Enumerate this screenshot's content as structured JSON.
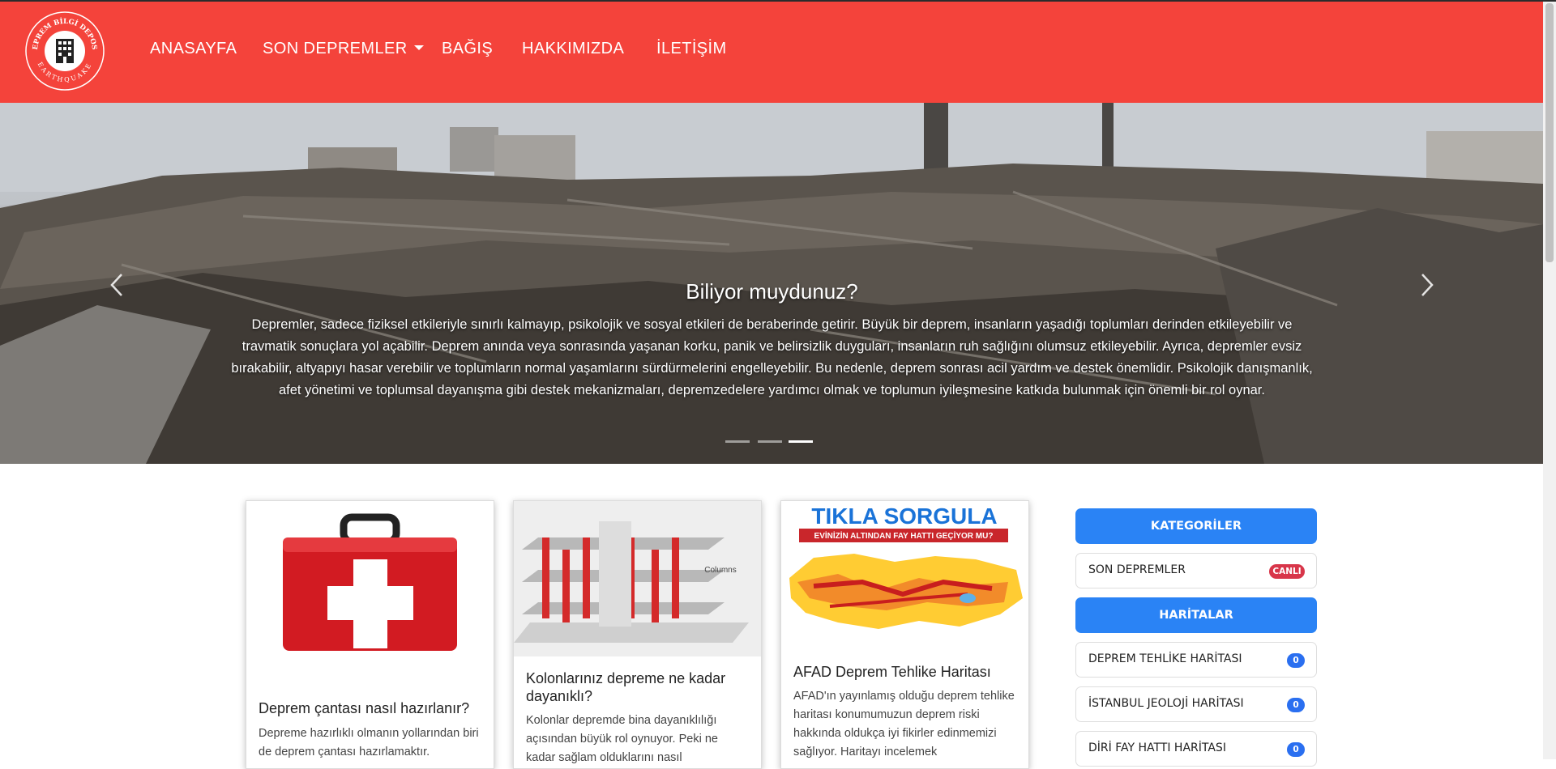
{
  "logo": {
    "ring_top": "DEPREM BİLGİ DEPOSU",
    "ring_bottom": "EARTHQUAKE"
  },
  "nav": {
    "items": [
      "ANASAYFA",
      "SON DEPREMLER",
      "BAĞIŞ",
      "HAKKIMIZDA",
      "İLETİŞİM"
    ]
  },
  "hero": {
    "title": "Biliyor muydunuz?",
    "text": "Depremler, sadece fiziksel etkileriyle sınırlı kalmayıp, psikolojik ve sosyal etkileri de beraberinde getirir. Büyük bir deprem, insanların yaşadığı toplumları derinden etkileyebilir ve travmatik sonuçlara yol açabilir. Deprem anında veya sonrasında yaşanan korku, panik ve belirsizlik duyguları, insanların ruh sağlığını olumsuz etkileyebilir. Ayrıca, depremler evsiz bırakabilir, altyapıyı hasar verebilir ve toplumların normal yaşamlarını sürdürmelerini engelleyebilir. Bu nedenle, deprem sonrası acil yardım ve destek önemlidir. Psikolojik danışmanlık, afet yönetimi ve toplumsal dayanışma gibi destek mekanizmaları, depremzedelere yardımcı olmak ve toplumun iyileşmesine katkıda bulunmak için önemli bir rol oynar.",
    "slide_count": 3,
    "active_slide": 3
  },
  "cards": [
    {
      "title": "Deprem çantası nasıl hazırlanır?",
      "text": "Depreme hazırlıklı olmanın yollarından biri de deprem çantası hazırlamaktır."
    },
    {
      "title": "Kolonlarınız depreme ne kadar dayanıklı?",
      "text": "Kolonlar depremde bina dayanıklılığı açısından büyük rol oynuyor. Peki ne kadar sağlam olduklarını nasıl",
      "image_label": "Columns"
    },
    {
      "title": "AFAD Deprem Tehlike Haritası",
      "text": "AFAD'ın yayınlamış olduğu deprem tehlike haritası konumumuzun deprem riski hakkında oldukça iyi fikirler edinmemizi sağlıyor. Haritayı incelemek",
      "image_title": "TIKLA SORGULA",
      "image_subtitle": "EVİNİZİN ALTINDAN FAY HATTI GEÇİYOR MU?"
    }
  ],
  "sidebar": {
    "categories_title": "KATEGORİLER",
    "categories": [
      {
        "label": "SON DEPREMLER",
        "badge": "CANLI"
      }
    ],
    "maps_title": "HARİTALAR",
    "maps": [
      {
        "label": "DEPREM TEHLİKE HARİTASI",
        "badge": "0"
      },
      {
        "label": "İSTANBUL JEOLOJİ HARİTASI",
        "badge": "0"
      },
      {
        "label": "DİRİ FAY HATTI HARİTASI",
        "badge": "0"
      }
    ]
  },
  "colors": {
    "brand_red": "#f4433b",
    "accent_blue": "#2a83f5",
    "badge_red": "#d8364a",
    "badge_blue": "#2a6ff0"
  }
}
